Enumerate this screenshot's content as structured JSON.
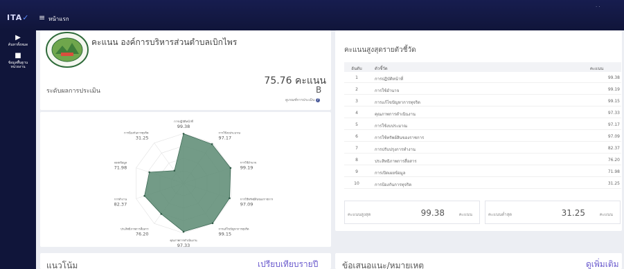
{
  "topbar": {
    "logo_main": "ITA",
    "logo_accent": "✓",
    "menu_icon": "hamburger-icon",
    "nav_label": "หน้าแรก",
    "right_text": "· ·"
  },
  "sidebar": {
    "items": [
      {
        "icon": "user-search-icon",
        "label_line1": "ค้นหาทั้งหมด",
        "label_line2": ""
      },
      {
        "icon": "building-icon",
        "label_line1": "ข้อมูลพื้นฐาน",
        "label_line2": "หน่วยงาน"
      }
    ]
  },
  "summary": {
    "title": "คะแนน องค์การบริหารส่วนตำบลเบิกไพร",
    "score_text": "75.76 คะแนน",
    "level_label": "ระดับผลการประเมิน",
    "grade": "B",
    "criteria_text": "ดูเกณฑ์การประเมิน",
    "criteria_icon": "question-circle-icon"
  },
  "radar": {
    "labels": [
      {
        "name": "การปฏิบัติหน้าที่",
        "value": "99.38"
      },
      {
        "name": "การใช้งบประมาณ",
        "value": "97.17"
      },
      {
        "name": "การใช้อำนาจ",
        "value": "99.19"
      },
      {
        "name": "การใช้ทรัพย์สินของราชการ",
        "value": "97.09"
      },
      {
        "name": "การแก้ไขปัญหาการทุจริต",
        "value": "99.15"
      },
      {
        "name": "คุณภาพการดำเนินงาน",
        "value": "97.33"
      },
      {
        "name": "ประสิทธิภาพการสื่อสาร",
        "value": "76.20"
      },
      {
        "name": "การปรับปรุงการทำงาน",
        "value": "82.37"
      },
      {
        "name": "การเปิดเผยข้อมูล",
        "value": "71.98"
      },
      {
        "name": "การป้องกันการทุจริต",
        "value": "31.25"
      }
    ],
    "fill_color": "#5b8a72"
  },
  "ranking": {
    "title": "คะแนนสูงสุดรายตัวชี้วัด",
    "headers": {
      "rank": "อันดับ",
      "name": "ตัวชี้วัด",
      "score": "คะแนน"
    },
    "rows": [
      {
        "rank": "1",
        "name": "การปฏิบัติหน้าที่",
        "score": "99.38"
      },
      {
        "rank": "2",
        "name": "การใช้อำนาจ",
        "score": "99.19"
      },
      {
        "rank": "3",
        "name": "การแก้ไขปัญหาการทุจริต",
        "score": "99.15"
      },
      {
        "rank": "4",
        "name": "คุณภาพการดำเนินงาน",
        "score": "97.33"
      },
      {
        "rank": "5",
        "name": "การใช้งบประมาณ",
        "score": "97.17"
      },
      {
        "rank": "6",
        "name": "การใช้ทรัพย์สินของราชการ",
        "score": "97.09"
      },
      {
        "rank": "7",
        "name": "การปรับปรุงการทำงาน",
        "score": "82.37"
      },
      {
        "rank": "8",
        "name": "ประสิทธิภาพการสื่อสาร",
        "score": "76.20"
      },
      {
        "rank": "9",
        "name": "การเปิดเผยข้อมูล",
        "score": "71.98"
      },
      {
        "rank": "10",
        "name": "การป้องกันการทุจริต",
        "score": "31.25"
      }
    ],
    "max_label": "คะแนนสูงสุด",
    "max_value": "99.38",
    "min_label": "คะแนนต่ำสุด",
    "min_value": "31.25",
    "unit": "คะแนน"
  },
  "bottom": {
    "trend_title": "แนวโน้ม",
    "trend_link": "เปรียบเทียบรายปี",
    "suggest_title": "ข้อเสนอแนะ/หมายเหตุ",
    "suggest_link": "ดูเพิ่มเติม"
  },
  "colors": {
    "nav_bg": "#10153a",
    "accent": "#6a5acd",
    "radar_fill": "#5b8a72"
  }
}
